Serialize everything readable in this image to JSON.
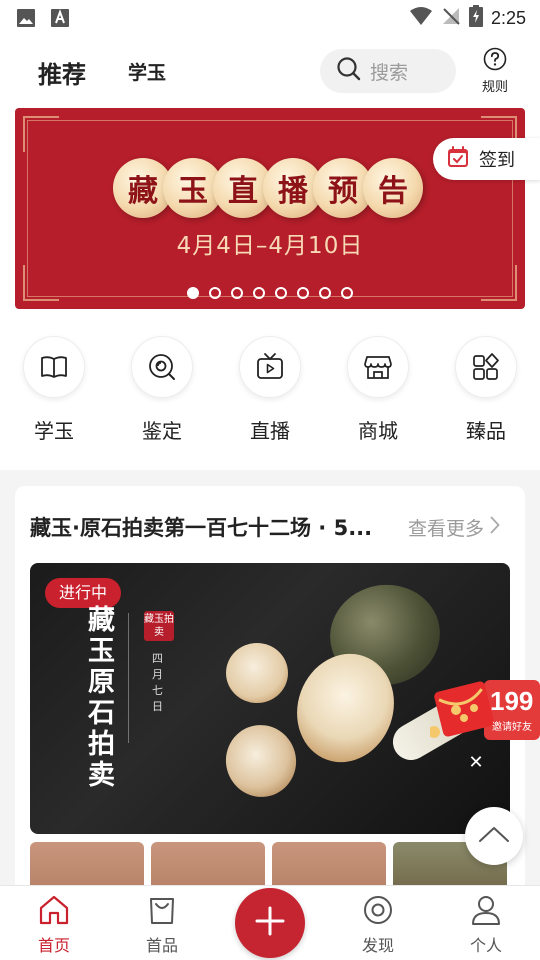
{
  "status_bar": {
    "time": "2:25"
  },
  "header": {
    "tabs": [
      {
        "label": "推荐",
        "active": true
      },
      {
        "label": "学玉",
        "active": false
      }
    ],
    "search_placeholder": "搜索",
    "rules_label": "规则"
  },
  "banner": {
    "title_chars": [
      "藏",
      "玉",
      "直",
      "播",
      "预",
      "告"
    ],
    "date_range": "4月4日–4月10日",
    "slide_count": 8,
    "active_slide": 0
  },
  "checkin": {
    "label": "签到"
  },
  "quick_nav": [
    {
      "label": "学玉",
      "icon": "book-icon"
    },
    {
      "label": "鉴定",
      "icon": "appraisal-icon"
    },
    {
      "label": "直播",
      "icon": "tv-play-icon"
    },
    {
      "label": "商城",
      "icon": "store-icon"
    },
    {
      "label": "臻品",
      "icon": "grid-diamond-icon"
    }
  ],
  "auction": {
    "title": "藏玉·原石拍卖第一百七十二场 · 5...",
    "more_label": "查看更多",
    "status": "进行中",
    "hero_title": "藏玉原石拍卖",
    "seal_text": "藏玉拍卖",
    "hero_date": "四月七日"
  },
  "red_packet": {
    "amount": "199",
    "subtitle": "邀请好友"
  },
  "bottom_nav": [
    {
      "label": "首页",
      "icon": "home-icon",
      "active": true
    },
    {
      "label": "首品",
      "icon": "bag-icon",
      "active": false
    },
    {
      "label": "发现",
      "icon": "discover-icon",
      "active": false
    },
    {
      "label": "个人",
      "icon": "person-icon",
      "active": false
    }
  ],
  "colors": {
    "brand_red": "#c52431",
    "banner_red": "#b51e2a",
    "gold": "#f7d9b6"
  }
}
